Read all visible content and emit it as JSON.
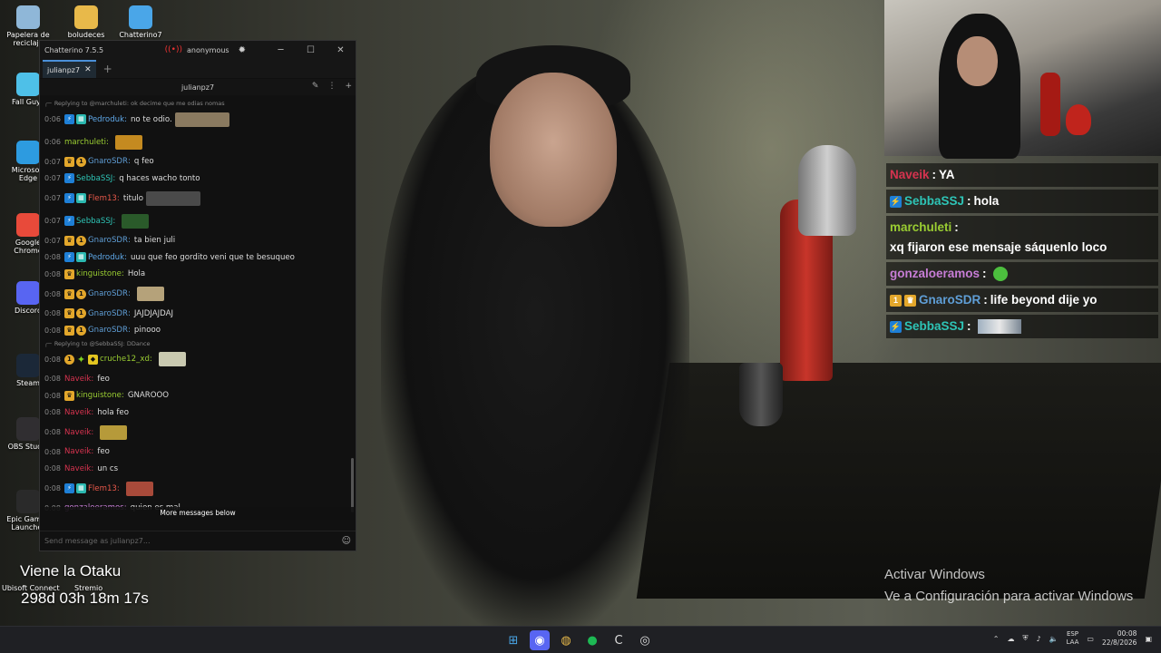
{
  "window": {
    "title": "Chatterino 7.5.5",
    "account": "anonymous",
    "tab_label": "julianpz7",
    "channel": "julianpz7",
    "input_placeholder": "Send message as julianpz7...",
    "more_messages": "More messages below"
  },
  "messages": [
    {
      "type": "reply",
      "text": "Replying to @marchuleti: ok decime que me odias nomas"
    },
    {
      "ts": "0:06",
      "badges": [
        "prime",
        "sub"
      ],
      "nick": "Pedroduk",
      "color": "#5fa8e8",
      "text": "no te odio.",
      "emote": "#8a7a60"
    },
    {
      "ts": "0:06",
      "badges": [],
      "nick": "marchuleti",
      "color": "#9acd32",
      "text": "",
      "emote": "#c48a20"
    },
    {
      "ts": "0:07",
      "badges": [
        "crown",
        "num"
      ],
      "nick": "GnaroSDR",
      "color": "#5f9ed6",
      "text": "q feo"
    },
    {
      "ts": "0:07",
      "badges": [
        "prime"
      ],
      "nick": "SebbaSSJ",
      "color": "#2ec4b6",
      "text": "q haces wacho tonto"
    },
    {
      "ts": "0:07",
      "badges": [
        "prime",
        "sub"
      ],
      "nick": "Flem13",
      "color": "#e8584a",
      "text": "titulo",
      "emote": "#4a4a4a"
    },
    {
      "ts": "0:07",
      "badges": [
        "prime"
      ],
      "nick": "SebbaSSJ",
      "color": "#2ec4b6",
      "text": "",
      "emote": "#2a5a2a"
    },
    {
      "ts": "0:07",
      "badges": [
        "crown",
        "num"
      ],
      "nick": "GnaroSDR",
      "color": "#5f9ed6",
      "text": "ta bien juli"
    },
    {
      "ts": "0:08",
      "badges": [
        "prime",
        "sub"
      ],
      "nick": "Pedroduk",
      "color": "#5fa8e8",
      "text": "uuu que feo gordito veni que te besuqueo"
    },
    {
      "ts": "0:08",
      "badges": [
        "crown"
      ],
      "nick": "kinguistone",
      "color": "#9acd32",
      "text": "Hola"
    },
    {
      "ts": "0:08",
      "badges": [
        "crown",
        "num"
      ],
      "nick": "GnaroSDR",
      "color": "#5f9ed6",
      "text": "",
      "emote": "#b5a27a"
    },
    {
      "ts": "0:08",
      "badges": [
        "crown",
        "num"
      ],
      "nick": "GnaroSDR",
      "color": "#5f9ed6",
      "text": "JAJDJAJDAJ"
    },
    {
      "ts": "0:08",
      "badges": [
        "crown",
        "num"
      ],
      "nick": "GnaroSDR",
      "color": "#5f9ed6",
      "text": "pinooo"
    },
    {
      "type": "reply",
      "text": "Replying to @SebbaSSJ: DDance"
    },
    {
      "ts": "0:08",
      "badges": [
        "num",
        "spark",
        "bits"
      ],
      "nick": "cruche12_xd",
      "color": "#9acd32",
      "text": "",
      "emote": "#c9c9b0"
    },
    {
      "ts": "0:08",
      "badges": [],
      "nick": "Naveik",
      "color": "#d6334f",
      "text": "feo"
    },
    {
      "ts": "0:08",
      "badges": [
        "crown"
      ],
      "nick": "kinguistone",
      "color": "#9acd32",
      "text": "GNAROOO"
    },
    {
      "ts": "0:08",
      "badges": [],
      "nick": "Naveik",
      "color": "#d6334f",
      "text": "hola feo"
    },
    {
      "ts": "0:08",
      "badges": [],
      "nick": "Naveik",
      "color": "#d6334f",
      "text": "",
      "emote": "#b69a3a"
    },
    {
      "ts": "0:08",
      "badges": [],
      "nick": "Naveik",
      "color": "#d6334f",
      "text": "feo"
    },
    {
      "ts": "0:08",
      "badges": [],
      "nick": "Naveik",
      "color": "#d6334f",
      "text": "un cs"
    },
    {
      "ts": "0:08",
      "badges": [
        "prime",
        "sub"
      ],
      "nick": "Flem13",
      "color": "#e8584a",
      "text": "",
      "emote": "#a84a3a"
    },
    {
      "ts": "0:08",
      "badges": [],
      "nick": "gonzaloeramos",
      "color": "#c77dd6",
      "text": "quien es mal"
    }
  ],
  "overlay_chat": [
    {
      "badges": [],
      "nick": "Naveik",
      "color": "#d6334f",
      "text": "YA"
    },
    {
      "badges": [
        "prime"
      ],
      "nick": "SebbaSSJ",
      "color": "#2ec4b6",
      "text": "hola"
    },
    {
      "badges": [],
      "nick": "marchuleti",
      "color": "#9acd32",
      "text": "xq fijaron ese mensaje sáquenlo loco"
    },
    {
      "badges": [],
      "nick": "gonzaloeramos",
      "color": "#c77dd6",
      "text": "",
      "emote": "smile"
    },
    {
      "badges": [
        "num",
        "crown"
      ],
      "nick": "GnaroSDR",
      "color": "#5f9ed6",
      "text": "life beyond dije yo"
    },
    {
      "badges": [
        "prime"
      ],
      "nick": "SebbaSSJ",
      "color": "#2ec4b6",
      "text": "",
      "emote": "image"
    }
  ],
  "desktop_icons": [
    {
      "label": "Papelera de reciclaje",
      "color": "#8fb7d8"
    },
    {
      "label": "boludeces",
      "color": "#e8b94a"
    },
    {
      "label": "Chatterino7",
      "color": "#4aa6e8"
    },
    {
      "label": "Fall Guys",
      "color": "#4ec0e8"
    },
    {
      "label": "Microsoft Edge",
      "color": "#2d9be0"
    },
    {
      "label": "Google Chrome",
      "color": "#e84a3a"
    },
    {
      "label": "Discord",
      "color": "#5865f2"
    },
    {
      "label": "Steam",
      "color": "#1b2838"
    },
    {
      "label": "OBS Studio",
      "color": "#302e31"
    },
    {
      "label": "Epic Games Launcher",
      "color": "#2a2a2a"
    }
  ],
  "overlay": {
    "title": "Viene la Otaku",
    "uptime": "298d 03h 18m 17s",
    "ubisoft": "Ubisoft Connect",
    "stremio": "Stremio"
  },
  "activate": {
    "line1": "Activar Windows",
    "line2": "Ve a Configuración para activar Windows"
  },
  "taskbar": {
    "lang1": "ESP",
    "lang2": "LAA",
    "time": "00:08",
    "date": "22/8/2026"
  }
}
